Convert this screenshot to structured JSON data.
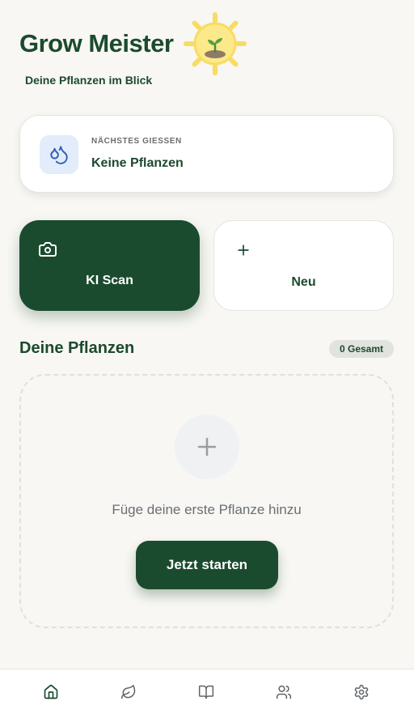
{
  "header": {
    "title": "Grow Meister",
    "subtitle": "Deine Pflanzen im Blick",
    "logo_icon": "sun-with-sprout-icon"
  },
  "next_watering": {
    "label": "NÄCHSTES GIESSEN",
    "value": "Keine Pflanzen",
    "icon": "water-drops-icon"
  },
  "actions": {
    "scan": {
      "label": "KI Scan",
      "icon": "camera-icon"
    },
    "new": {
      "label": "Neu",
      "icon": "plus-icon"
    }
  },
  "plants": {
    "title": "Deine Pflanzen",
    "count_label": "0 Gesamt",
    "empty_text": "Füge deine erste Pflanze hinzu",
    "start_label": "Jetzt starten"
  },
  "bottom_nav": {
    "items": [
      {
        "name": "home",
        "icon": "home-icon",
        "active": true
      },
      {
        "name": "plants",
        "icon": "leaf-icon",
        "active": false
      },
      {
        "name": "guide",
        "icon": "book-icon",
        "active": false
      },
      {
        "name": "community",
        "icon": "users-icon",
        "active": false
      },
      {
        "name": "settings",
        "icon": "gear-icon",
        "active": false
      }
    ]
  },
  "colors": {
    "primary": "#1b4b2f",
    "background": "#f8f7f3",
    "sun": "#f8dc62",
    "drop_bg": "#e2ecfa",
    "drop_icon": "#2f5fb8"
  }
}
